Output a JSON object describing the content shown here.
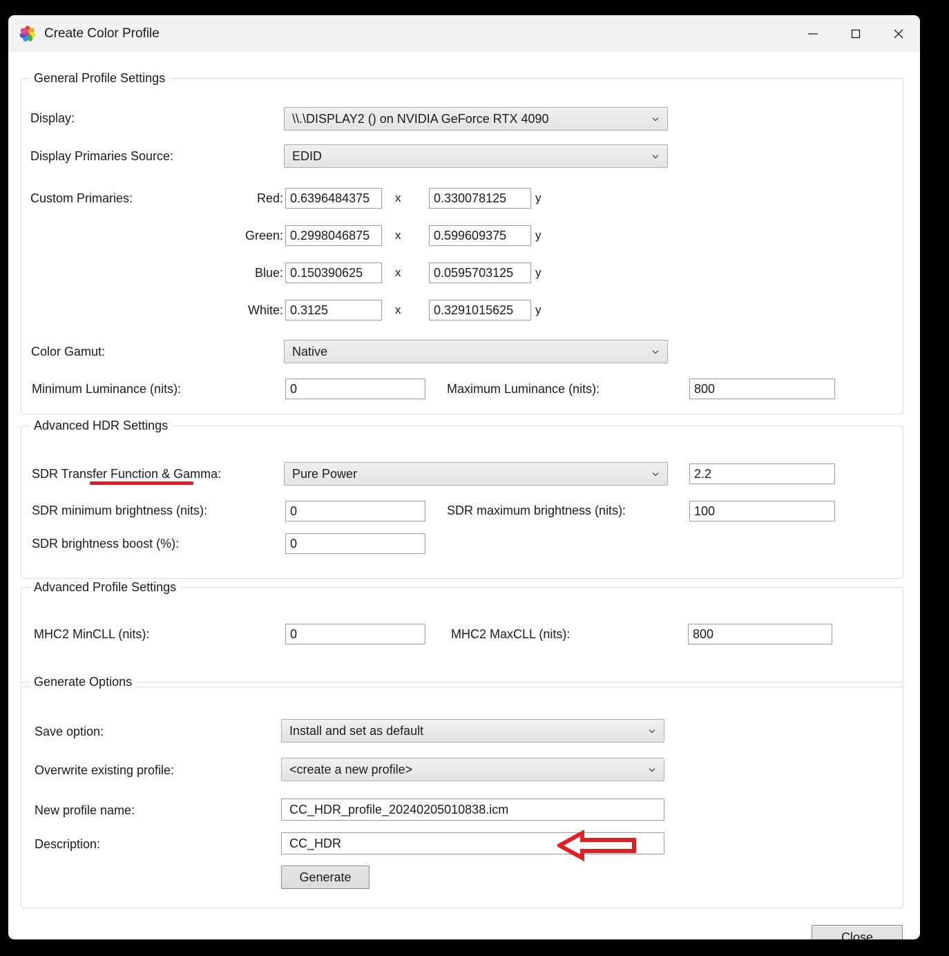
{
  "window": {
    "title": "Create Color Profile",
    "icon": "color-wheel-icon",
    "controls": {
      "minimize": "minimize-icon",
      "maximize": "maximize-icon",
      "close": "close-icon"
    }
  },
  "general": {
    "legend": "General Profile Settings",
    "display_label": "Display:",
    "display_value": "\\\\.\\DISPLAY2 () on NVIDIA GeForce RTX 4090",
    "primaries_source_label": "Display Primaries Source:",
    "primaries_source_value": "EDID",
    "custom_primaries_label": "Custom Primaries:",
    "primaries": [
      {
        "name": "Red:",
        "x": "0.6396484375",
        "y": "0.330078125"
      },
      {
        "name": "Green:",
        "x": "0.2998046875",
        "y": "0.599609375"
      },
      {
        "name": "Blue:",
        "x": "0.150390625",
        "y": "0.0595703125"
      },
      {
        "name": "White:",
        "x": "0.3125",
        "y": "0.3291015625"
      }
    ],
    "x_separator": "x",
    "y_suffix": "y",
    "gamut_label": "Color Gamut:",
    "gamut_value": "Native",
    "min_lum_label": "Minimum Luminance (nits):",
    "min_lum_value": "0",
    "max_lum_label": "Maximum Luminance (nits):",
    "max_lum_value": "800"
  },
  "hdr": {
    "legend": "Advanced HDR Settings",
    "transfer_label": "SDR Transfer Function & Gamma:",
    "transfer_value": "Pure Power",
    "gamma_value": "2.2",
    "sdr_min_label": "SDR minimum brightness (nits):",
    "sdr_min_value": "0",
    "sdr_max_label": "SDR maximum brightness (nits):",
    "sdr_max_value": "100",
    "sdr_boost_label": "SDR brightness boost (%):",
    "sdr_boost_value": "0"
  },
  "advanced": {
    "legend": "Advanced Profile Settings",
    "mincll_label": "MHC2 MinCLL (nits):",
    "mincll_value": "0",
    "maxcll_label": "MHC2 MaxCLL (nits):",
    "maxcll_value": "800"
  },
  "generate": {
    "legend": "Generate Options",
    "save_option_label": "Save option:",
    "save_option_value": "Install and set as default",
    "overwrite_label": "Overwrite existing profile:",
    "overwrite_value": "<create a new profile>",
    "profile_name_label": "New profile name:",
    "profile_name_value": "CC_HDR_profile_20240205010838.icm",
    "description_label": "Description:",
    "description_value": "CC_HDR",
    "generate_button": "Generate"
  },
  "footer": {
    "close_button": "Close"
  },
  "annotations": {
    "color": "#dd1f26",
    "underline_target": "Advanced HDR Settings",
    "arrow_target": "New profile name"
  }
}
